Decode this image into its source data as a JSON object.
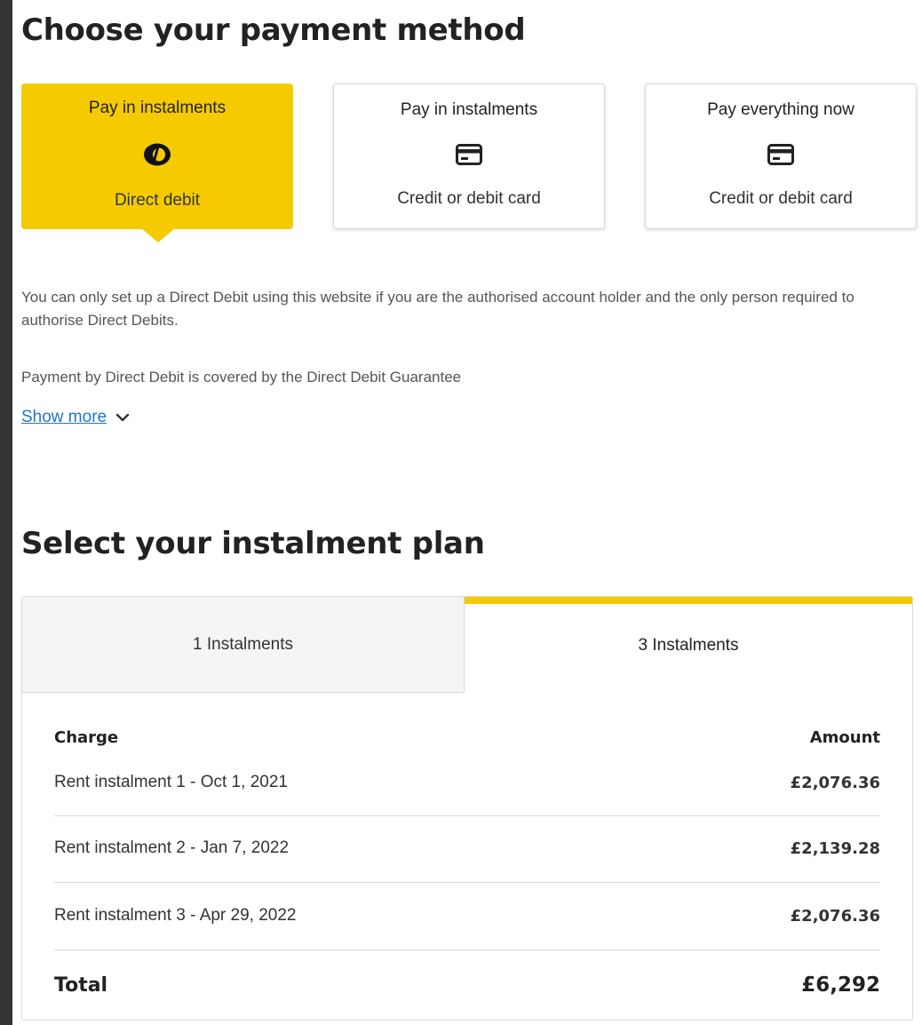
{
  "payment_method": {
    "heading": "Choose your payment method",
    "options": [
      {
        "title": "Pay in instalments",
        "subtitle": "Direct debit",
        "icon": "direct-debit-icon",
        "selected": true
      },
      {
        "title": "Pay in instalments",
        "subtitle": "Credit or debit card",
        "icon": "credit-card-icon",
        "selected": false
      },
      {
        "title": "Pay everything now",
        "subtitle": "Credit or debit card",
        "icon": "credit-card-icon",
        "selected": false
      }
    ],
    "info_1": "You can only set up a Direct Debit using this website if you are the authorised account holder and the only person required to authorise Direct Debits.",
    "info_2": "Payment by Direct Debit is covered by the Direct Debit Guarantee",
    "show_more": "Show more",
    "show_more_icon": "chevron-down-icon"
  },
  "instalment_plan": {
    "heading": "Select your instalment plan",
    "tabs": [
      {
        "label": "1 Instalments",
        "selected": false
      },
      {
        "label": "3 Instalments",
        "selected": true
      }
    ],
    "table": {
      "charge_header": "Charge",
      "amount_header": "Amount",
      "rows": [
        {
          "charge": "Rent instalment 1 - Oct 1, 2021",
          "amount": "£2,076.36"
        },
        {
          "charge": "Rent instalment 2 - Jan 7, 2022",
          "amount": "£2,139.28"
        },
        {
          "charge": "Rent instalment 3 - Apr 29, 2022",
          "amount": "£2,076.36"
        }
      ],
      "total_label": "Total",
      "total_amount": "£6,292"
    }
  },
  "colors": {
    "accent": "#f5cb00",
    "link": "#1f77c9",
    "border": "#d8d8d8"
  }
}
